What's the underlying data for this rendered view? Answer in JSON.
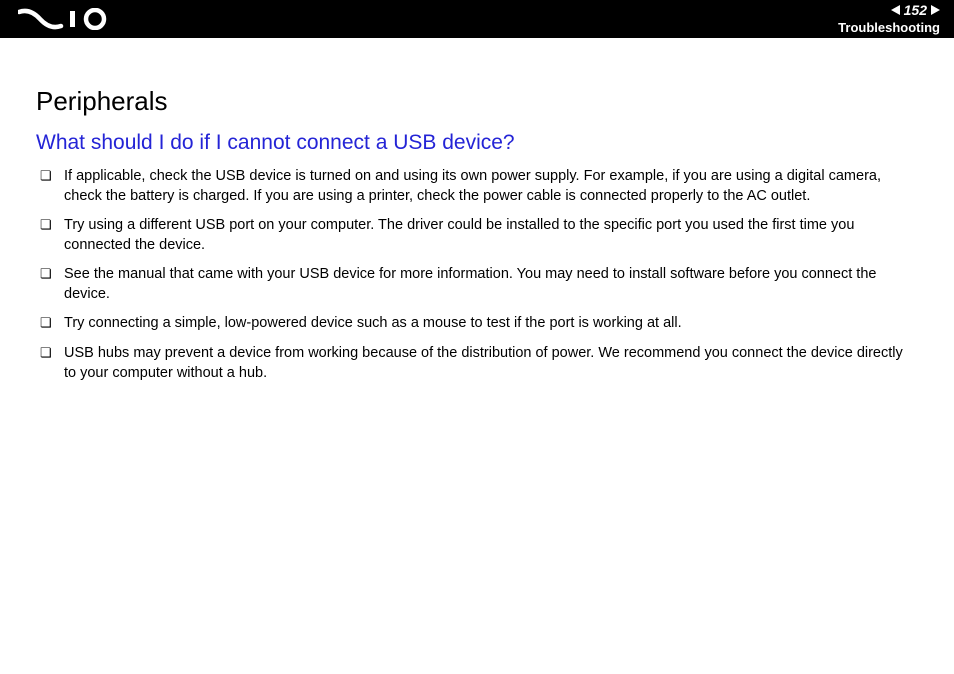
{
  "header": {
    "page_number": "152",
    "section": "Troubleshooting"
  },
  "content": {
    "title": "Peripherals",
    "question": "What should I do if I cannot connect a USB device?",
    "items": [
      "If applicable, check the USB device is turned on and using its own power supply. For example, if you are using a digital camera, check the battery is charged. If you are using a printer, check the power cable is connected properly to the AC outlet.",
      "Try using a different USB port on your computer. The driver could be installed to the specific port you used the first time you connected the device.",
      "See the manual that came with your USB device for more information. You may need to install software before you connect the device.",
      "Try connecting a simple, low-powered device such as a mouse to test if the port is working at all.",
      "USB hubs may prevent a device from working because of the distribution of power. We recommend you connect the device directly to your computer without a hub."
    ]
  }
}
